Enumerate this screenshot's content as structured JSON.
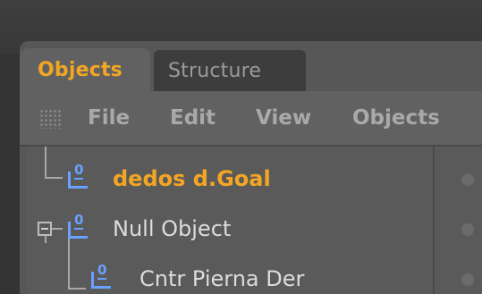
{
  "tabs": [
    {
      "label": "Objects",
      "active": true
    },
    {
      "label": "Structure",
      "active": false
    }
  ],
  "menu": {
    "file": "File",
    "edit": "Edit",
    "view": "View",
    "objects": "Objects"
  },
  "tree": {
    "items": [
      {
        "label": "dedos d.Goal",
        "icon": "null-object-icon",
        "selected": true
      },
      {
        "label": "Null Object",
        "icon": "null-object-icon",
        "expanded": true
      },
      {
        "label": "Cntr Pierna Der",
        "icon": "null-object-icon"
      }
    ]
  },
  "colors": {
    "accent": "#f2a623",
    "icon": "#6aa0ff",
    "panel": "#575757",
    "menubar": "#616161"
  }
}
